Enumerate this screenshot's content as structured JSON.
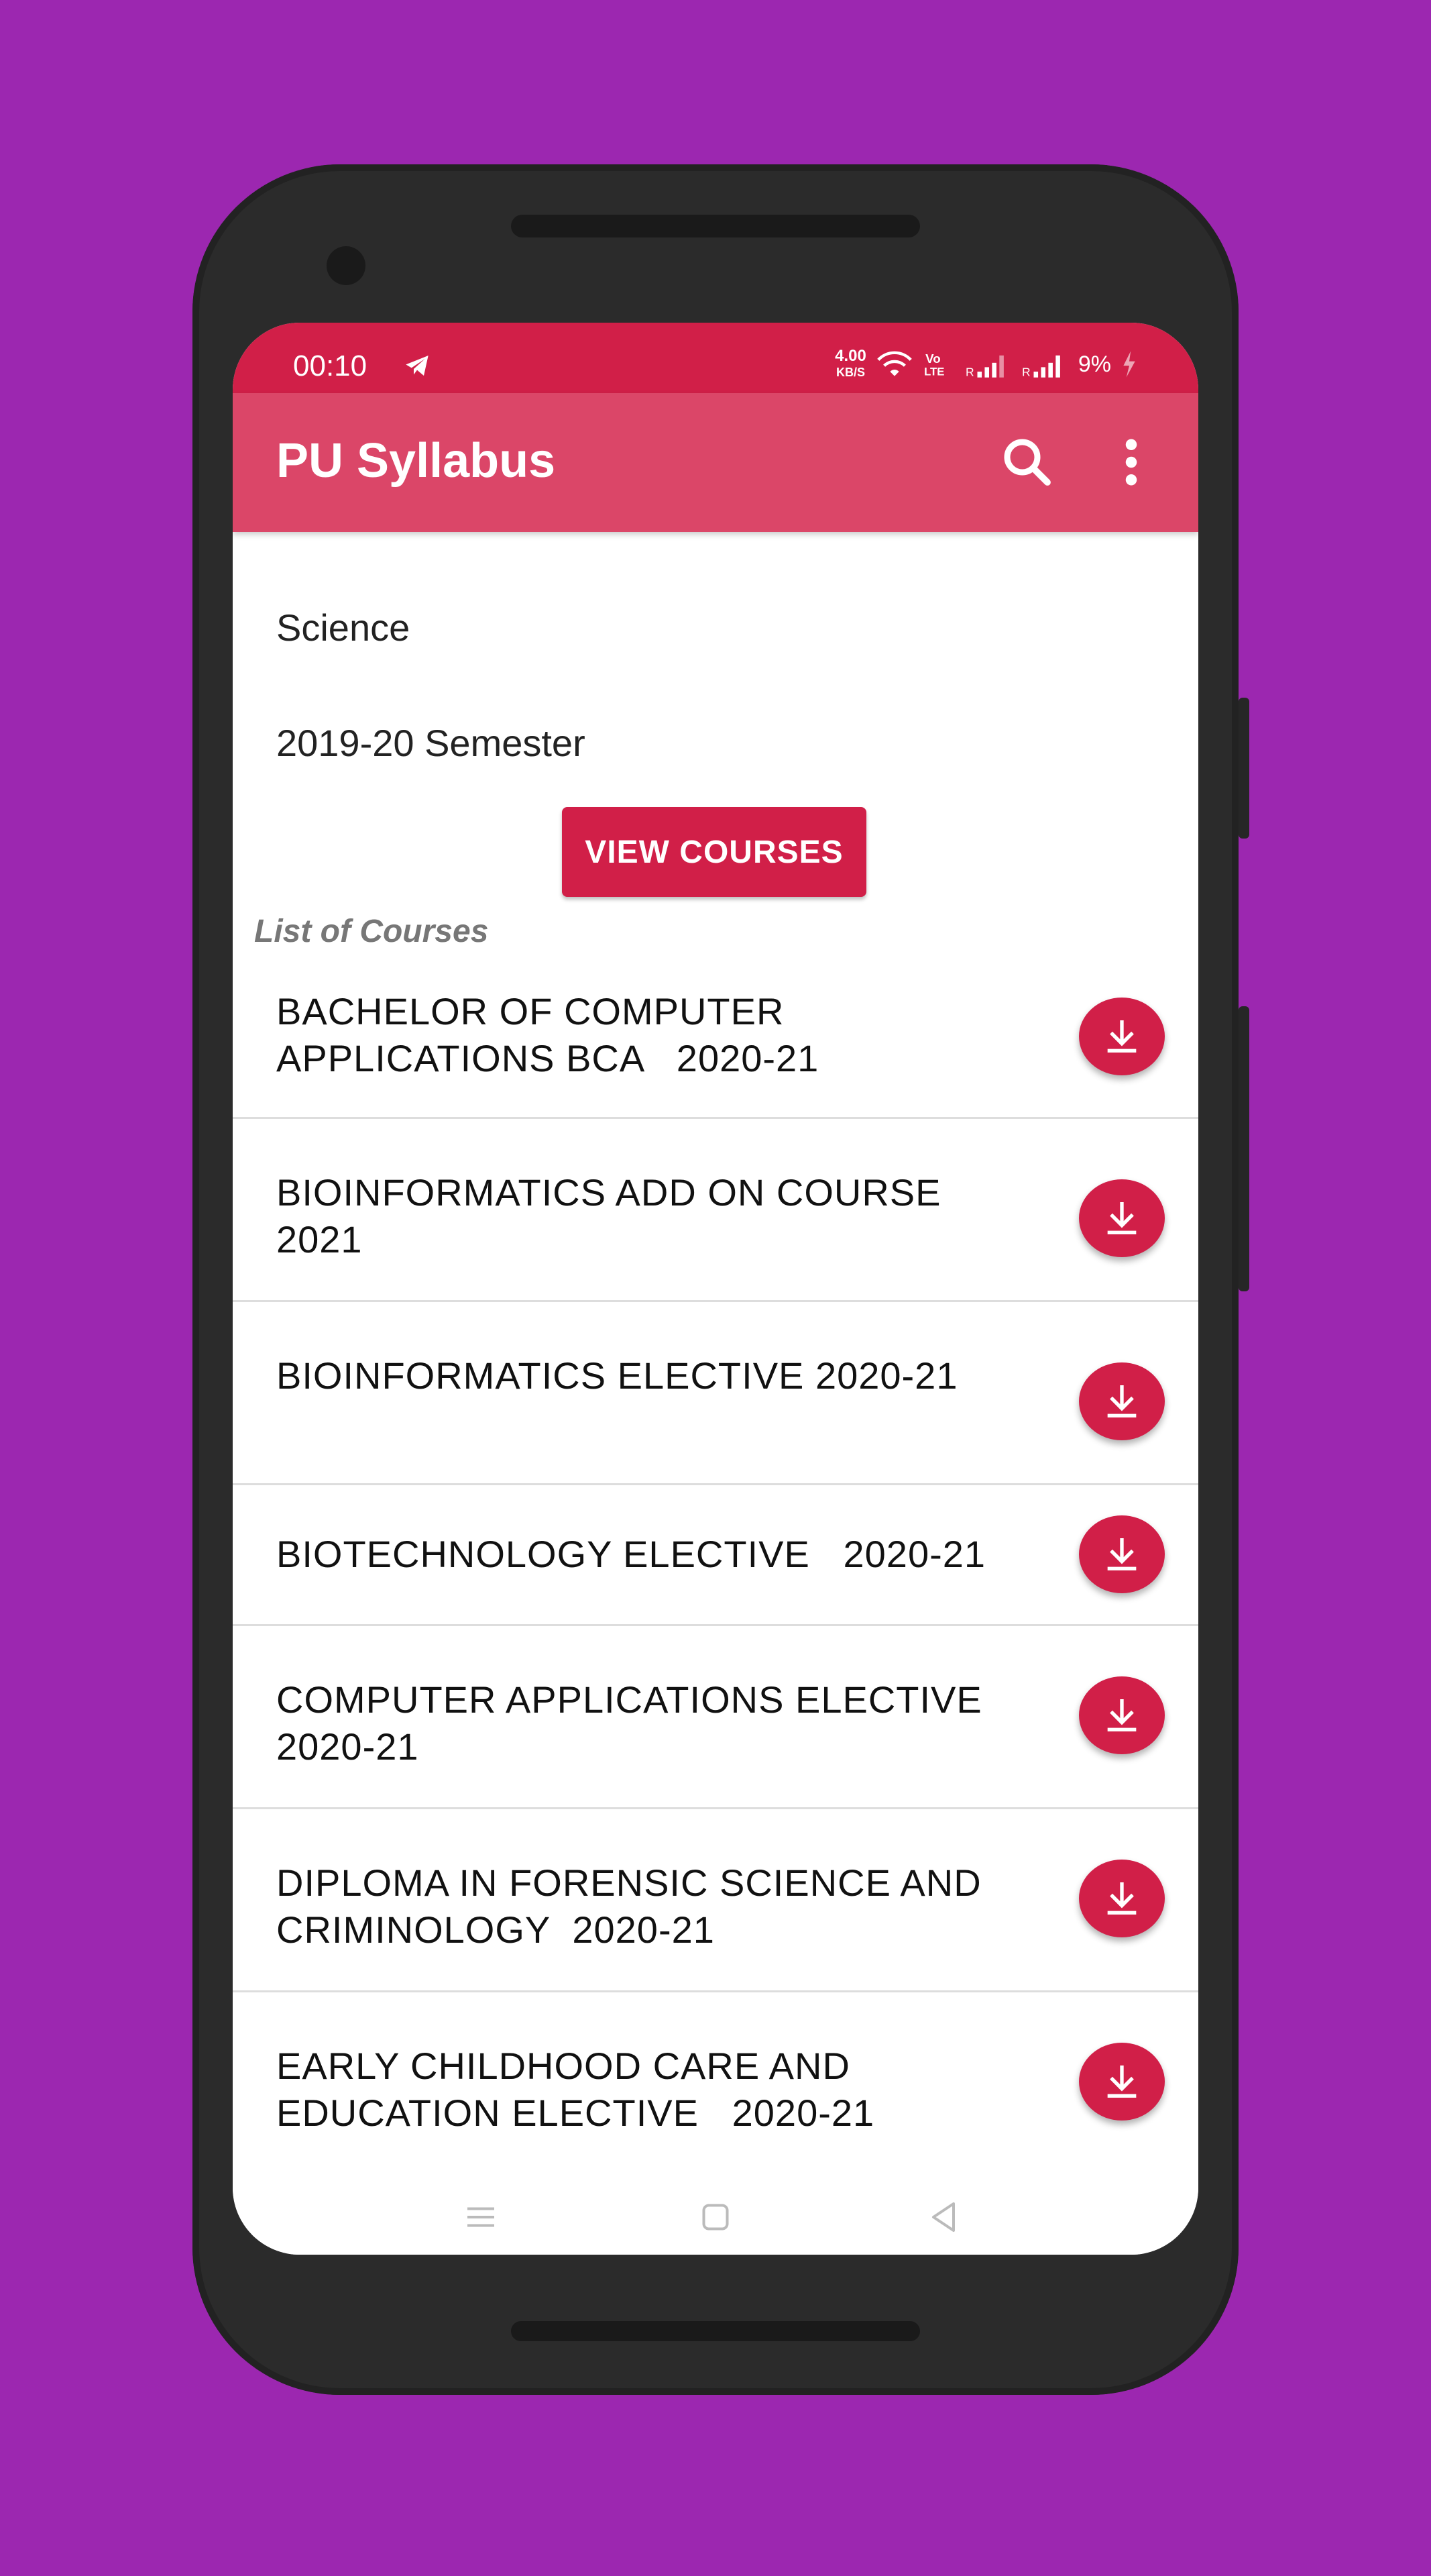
{
  "status": {
    "time": "00:10",
    "speed_value": "4.00",
    "speed_unit": "KB/S",
    "battery": "9%"
  },
  "appbar": {
    "title": "PU Syllabus"
  },
  "form": {
    "faculty": "Science",
    "session": "2019-20 Semester",
    "view_button": "VIEW COURSES"
  },
  "list_label": "List of Courses",
  "courses": [
    "BACHELOR OF COMPUTER APPLICATIONS BCA   2020-21",
    "BIOINFORMATICS ADD ON COURSE 2021",
    "BIOINFORMATICS ELECTIVE 2020-21",
    "BIOTECHNOLOGY ELECTIVE   2020-21",
    "COMPUTER APPLICATIONS ELECTIVE 2020-21",
    "DIPLOMA IN FORENSIC SCIENCE AND CRIMINOLOGY  2020-21",
    "EARLY CHILDHOOD CARE AND EDUCATION ELECTIVE   2020-21"
  ],
  "colors": {
    "background": "#9C27B0",
    "accent": "#D11F48",
    "appbar": "#DB4668"
  }
}
